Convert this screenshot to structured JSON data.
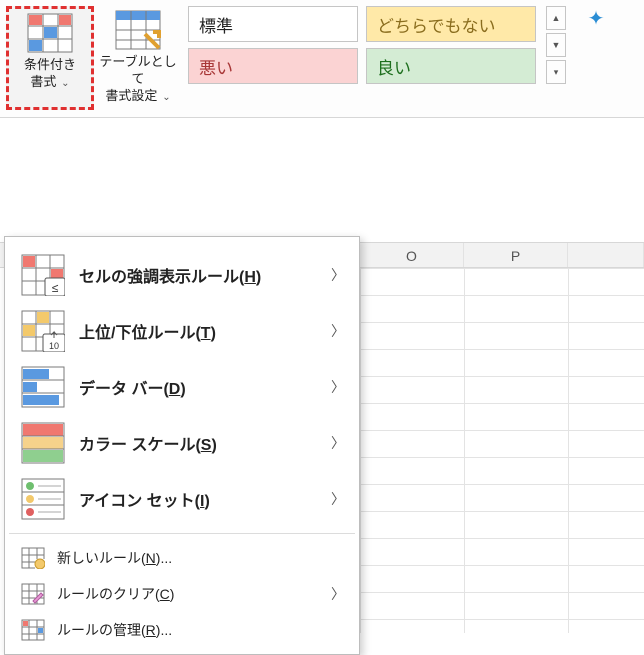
{
  "ribbon": {
    "cond_format": {
      "label_l1": "条件付き",
      "label_l2": "書式"
    },
    "table_format": {
      "label_l1": "テーブルとして",
      "label_l2": "書式設定"
    },
    "styles": {
      "normal": "標準",
      "neutral": "どちらでもない",
      "bad": "悪い",
      "good": "良い"
    }
  },
  "columns": {
    "o": "O",
    "p": "P"
  },
  "menu": {
    "highlight": {
      "label": "セルの強調表示ルール",
      "accel": "H"
    },
    "toprank": {
      "label": "上位/下位ルール",
      "accel": "T"
    },
    "databar": {
      "label": "データ バー",
      "accel": "D"
    },
    "colorscale": {
      "label": "カラー スケール",
      "accel": "S"
    },
    "iconset": {
      "label": "アイコン セット",
      "accel": "I"
    },
    "newrule": {
      "label": "新しいルール",
      "accel": "N",
      "ellipsis": "..."
    },
    "clear": {
      "label": "ルールのクリア",
      "accel": "C"
    },
    "manage": {
      "label": "ルールの管理",
      "accel": "R",
      "ellipsis": "..."
    }
  }
}
